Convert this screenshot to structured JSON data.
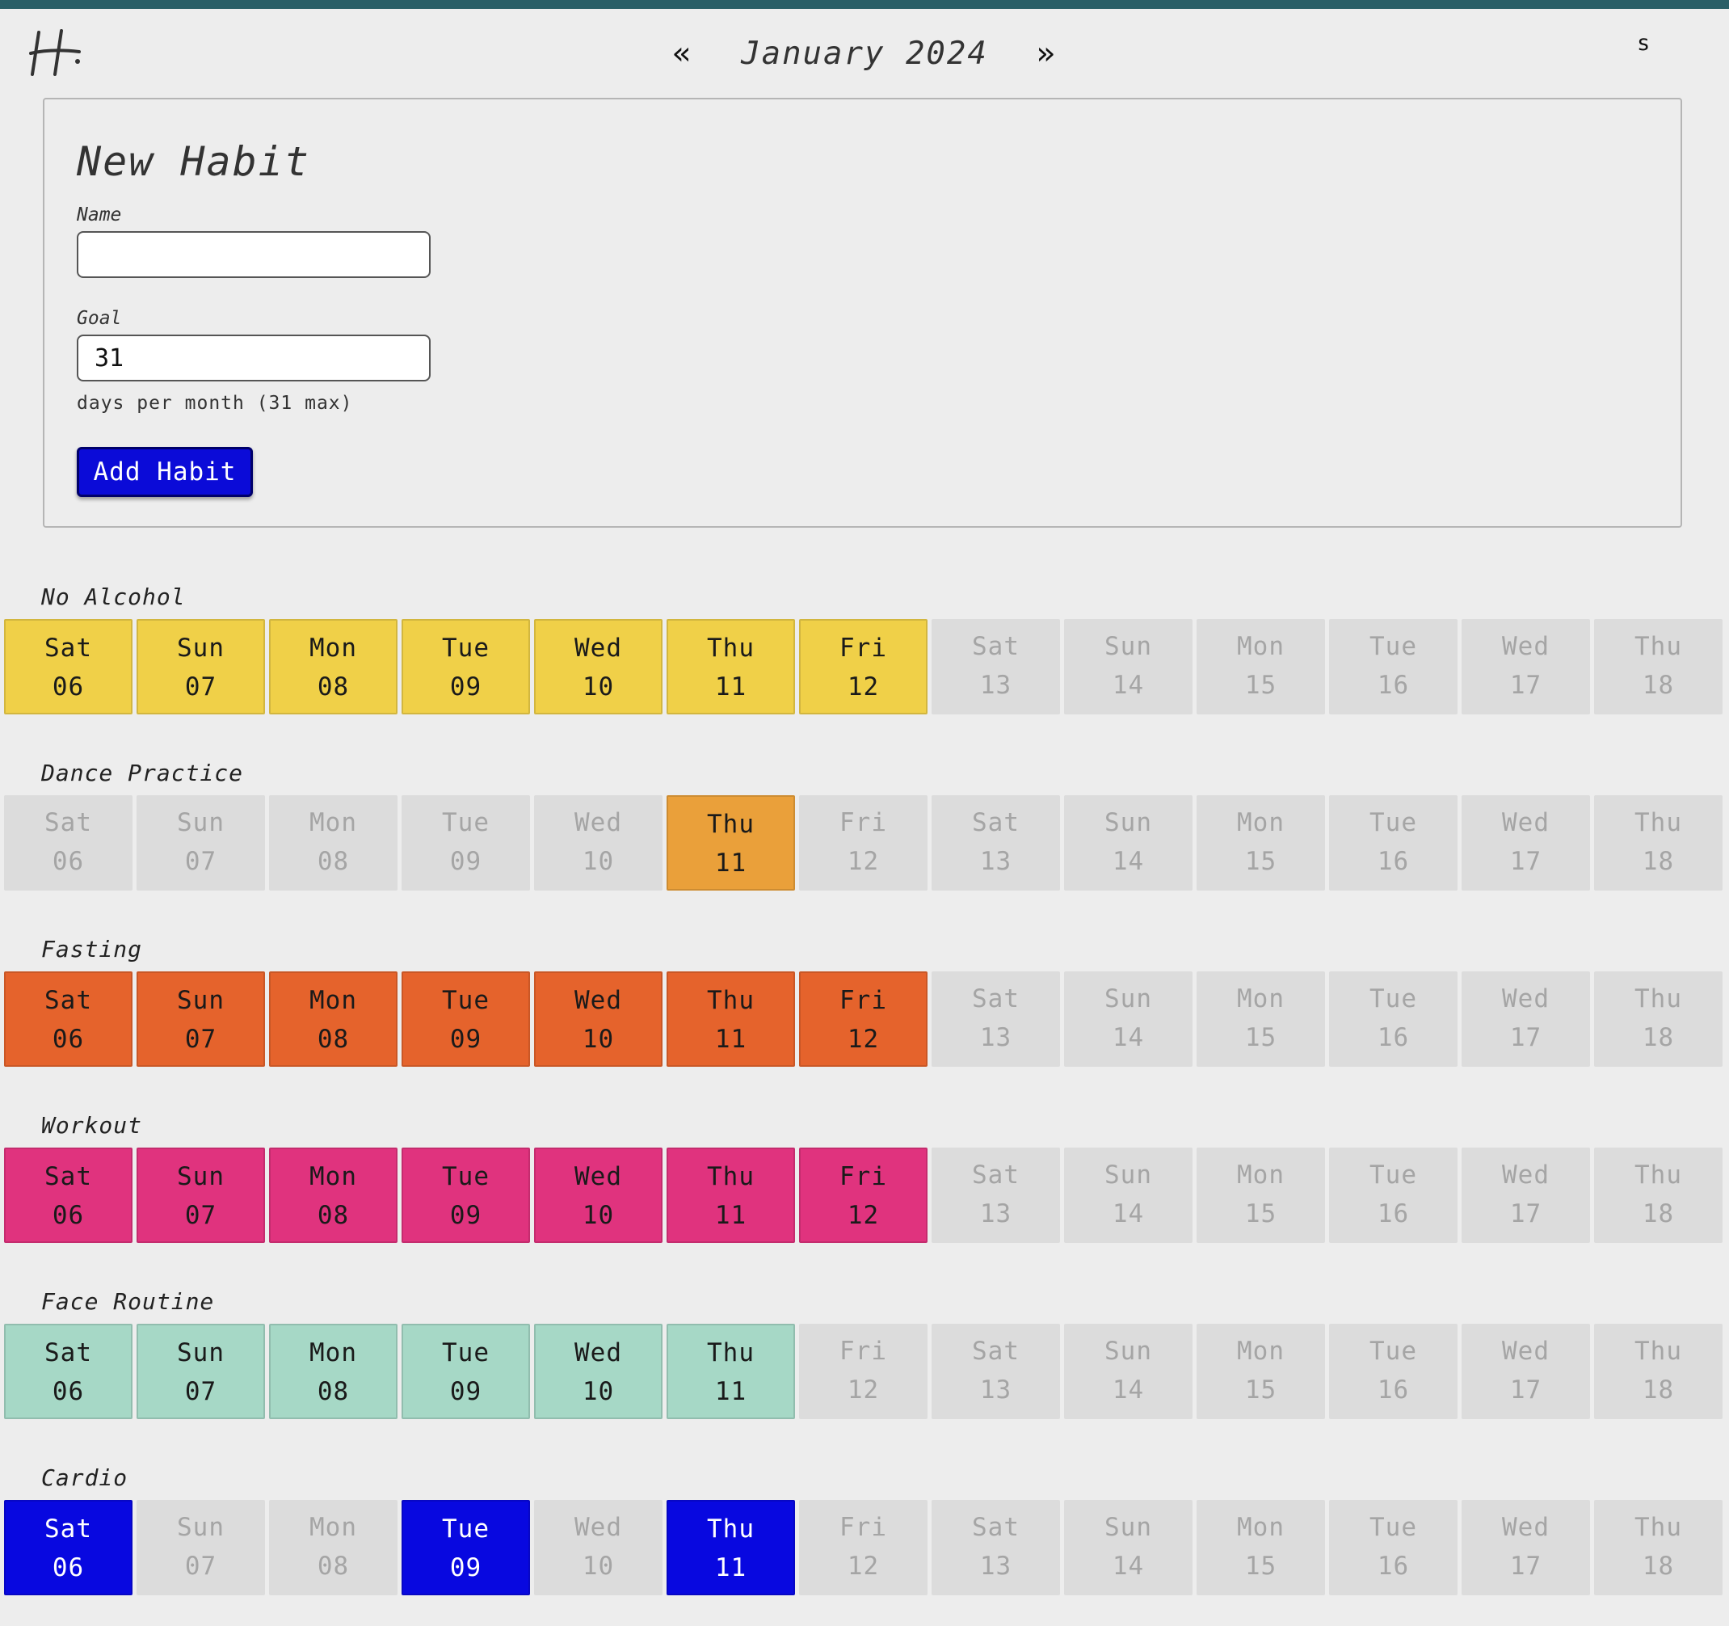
{
  "header": {
    "logo_text": "H",
    "prev_label": "«",
    "month_label": "January 2024",
    "next_label": "»",
    "corner_label": "s"
  },
  "form": {
    "title": "New Habit",
    "name_label": "Name",
    "name_value": "",
    "goal_label": "Goal",
    "goal_value": "31",
    "goal_hint": "days per month (31 max)",
    "submit_label": "Add Habit"
  },
  "days": [
    {
      "day": "Sat",
      "num": "06"
    },
    {
      "day": "Sun",
      "num": "07"
    },
    {
      "day": "Mon",
      "num": "08"
    },
    {
      "day": "Tue",
      "num": "09"
    },
    {
      "day": "Wed",
      "num": "10"
    },
    {
      "day": "Thu",
      "num": "11"
    },
    {
      "day": "Fri",
      "num": "12"
    },
    {
      "day": "Sat",
      "num": "13"
    },
    {
      "day": "Sun",
      "num": "14"
    },
    {
      "day": "Mon",
      "num": "15"
    },
    {
      "day": "Tue",
      "num": "16"
    },
    {
      "day": "Wed",
      "num": "17"
    },
    {
      "day": "Thu",
      "num": "18"
    }
  ],
  "habits": [
    {
      "name": "No Alcohol",
      "color": "#f0d048",
      "text_color": "#1a1a1a",
      "done": [
        true,
        true,
        true,
        true,
        true,
        true,
        true,
        false,
        false,
        false,
        false,
        false,
        false
      ]
    },
    {
      "name": "Dance Practice",
      "color": "#eaa03a",
      "text_color": "#1a1a1a",
      "done": [
        false,
        false,
        false,
        false,
        false,
        true,
        false,
        false,
        false,
        false,
        false,
        false,
        false
      ]
    },
    {
      "name": "Fasting",
      "color": "#e5632c",
      "text_color": "#1a1a1a",
      "done": [
        true,
        true,
        true,
        true,
        true,
        true,
        true,
        false,
        false,
        false,
        false,
        false,
        false
      ]
    },
    {
      "name": "Workout",
      "color": "#e0337e",
      "text_color": "#1a1a1a",
      "done": [
        true,
        true,
        true,
        true,
        true,
        true,
        true,
        false,
        false,
        false,
        false,
        false,
        false
      ]
    },
    {
      "name": "Face Routine",
      "color": "#a6d8c6",
      "text_color": "#1a1a1a",
      "done": [
        true,
        true,
        true,
        true,
        true,
        true,
        false,
        false,
        false,
        false,
        false,
        false,
        false
      ]
    },
    {
      "name": "Cardio",
      "color": "#0808e0",
      "text_color": "#ffffff",
      "done": [
        true,
        false,
        false,
        true,
        false,
        true,
        false,
        false,
        false,
        false,
        false,
        false,
        false
      ]
    }
  ]
}
